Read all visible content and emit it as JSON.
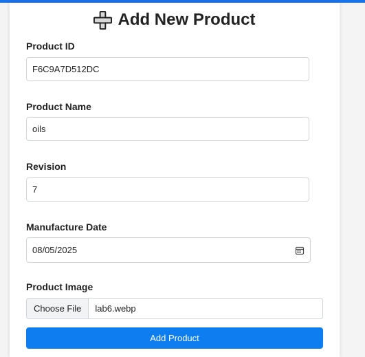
{
  "page": {
    "title": "Add New Product"
  },
  "form": {
    "product_id": {
      "label": "Product ID",
      "value": "F6C9A7D512DC"
    },
    "product_name": {
      "label": "Product Name",
      "value": "oils"
    },
    "revision": {
      "label": "Revision",
      "value": "7"
    },
    "manufacture_date": {
      "label": "Manufacture Date",
      "value": "08/05/2025"
    },
    "product_image": {
      "label": "Product Image",
      "button_label": "Choose File",
      "file_name": "lab6.webp"
    },
    "submit_label": "Add Product"
  },
  "icons": {
    "title_icon": "plus-icon",
    "date_icon": "calendar-icon"
  },
  "colors": {
    "accent": "#0d7df0",
    "top_bar": "#1a73e8"
  }
}
